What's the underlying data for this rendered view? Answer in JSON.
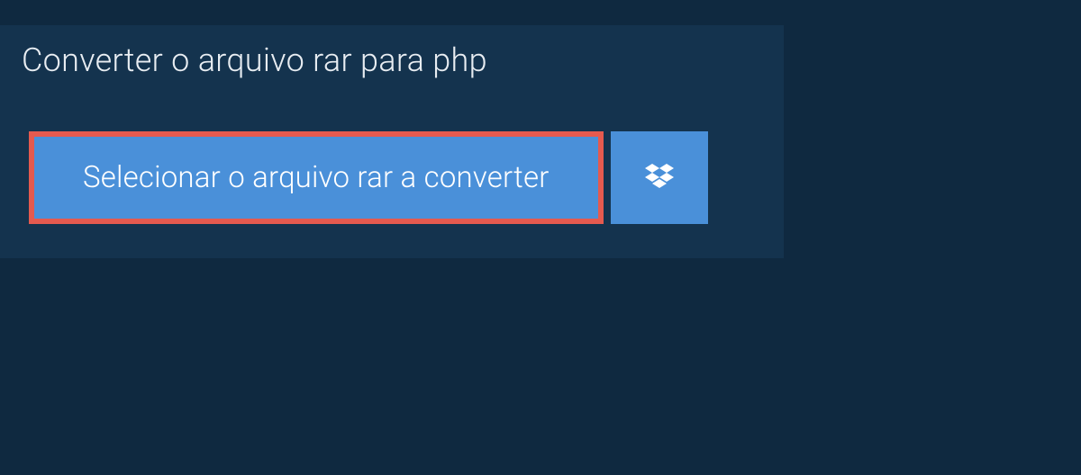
{
  "header": {
    "title": "Converter o arquivo rar para php"
  },
  "actions": {
    "select_file_label": "Selecionar o arquivo rar a converter"
  },
  "colors": {
    "page_bg": "#0f2940",
    "panel_bg": "#14334e",
    "button_bg": "#4a90d9",
    "highlight_border": "#e55a4f",
    "text_light": "#e8edf2",
    "text_white": "#ffffff"
  }
}
